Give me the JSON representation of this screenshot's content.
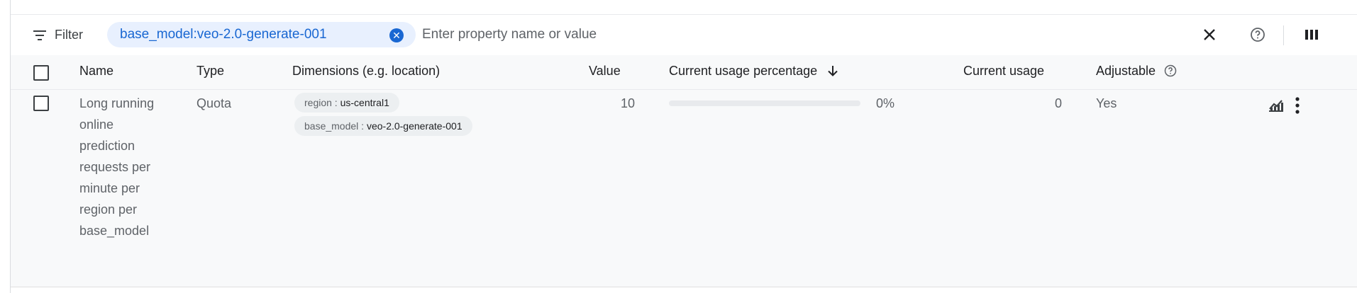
{
  "toolbar": {
    "filter_label": "Filter",
    "chip_text": "base_model:veo-2.0-generate-001",
    "input_placeholder": "Enter property name or value",
    "icons": [
      "filter-lines-icon",
      "chip-close-icon",
      "clear-icon",
      "help-icon",
      "column-display-icon"
    ]
  },
  "table": {
    "headers": {
      "name": "Name",
      "type": "Type",
      "dimensions": "Dimensions (e.g. location)",
      "value": "Value",
      "usage_pct": "Current usage percentage",
      "usage": "Current usage",
      "adjustable": "Adjustable"
    },
    "sort": {
      "column": "usage_pct",
      "direction": "descending",
      "icon": "arrow-down-icon"
    },
    "rows": [
      {
        "name": "Long running online prediction requests per minute per region per base_model",
        "type": "Quota",
        "dimensions": [
          {
            "key": "region",
            "sep": " : ",
            "value": "us-central1"
          },
          {
            "key": "base_model",
            "sep": " : ",
            "value": "veo-2.0-generate-001"
          }
        ],
        "value": "10",
        "usage_pct": 0,
        "usage_pct_label": "0%",
        "usage": "0",
        "adjustable": "Yes",
        "icons": [
          "monitoring-chart-icon",
          "more-vert-icon"
        ]
      }
    ]
  },
  "colors": {
    "chip_bg": "#e8f0fe",
    "chip_text": "#1967d2",
    "row_bg": "#f8f9fa",
    "progress_track": "#e8eaed"
  }
}
